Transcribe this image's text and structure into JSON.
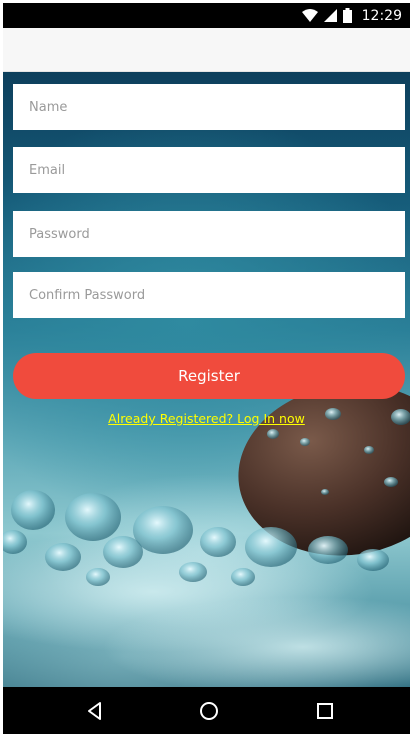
{
  "status_bar": {
    "time": "12:29",
    "icons": [
      "wifi-icon",
      "signal-icon",
      "battery-icon"
    ]
  },
  "form": {
    "name_placeholder": "Name",
    "email_placeholder": "Email",
    "password_placeholder": "Password",
    "confirm_password_placeholder": "Confirm Password",
    "register_label": "Register",
    "login_link": "Already Registered? Log In now"
  },
  "nav_bar": {
    "icons": [
      "back-icon",
      "home-icon",
      "recents-icon"
    ]
  },
  "colors": {
    "register_button": "#f04b3d",
    "login_link": "#ffff00",
    "status_bar": "#000000",
    "app_bar": "#f7f7f7"
  }
}
